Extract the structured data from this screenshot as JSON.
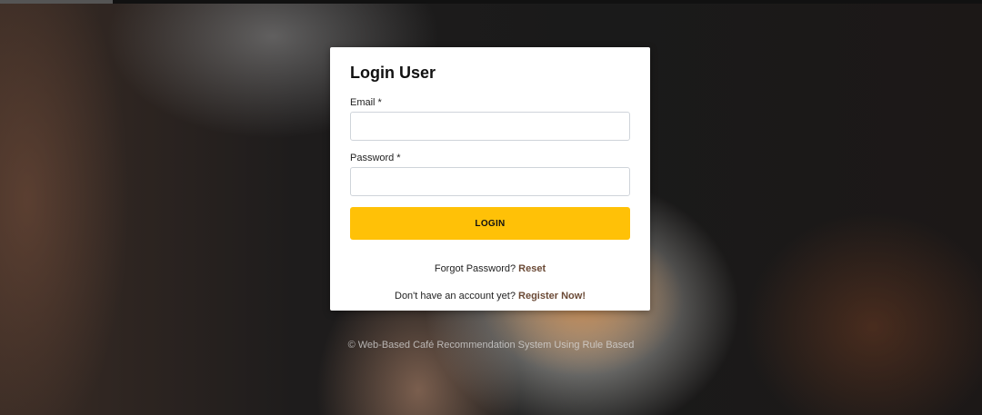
{
  "page": {
    "background_description": "blurred photo of latte art being poured",
    "colors": {
      "accent": "#ffc107",
      "link": "#6b4a36",
      "card_bg": "#ffffff"
    }
  },
  "login_card": {
    "title": "Login User",
    "email_label": "Email",
    "email_required_mark": "*",
    "email_value": "",
    "email_placeholder": "",
    "password_label": "Password",
    "password_required_mark": "*",
    "password_value": "",
    "password_placeholder": "",
    "login_button_label": "LOGIN",
    "forgot_text": "Forgot Password?",
    "forgot_link": "Reset",
    "register_text": "Don't have an account yet?",
    "register_link": "Register Now!"
  },
  "footer": {
    "copyright": "© Web-Based Café Recommendation System Using Rule Based"
  }
}
